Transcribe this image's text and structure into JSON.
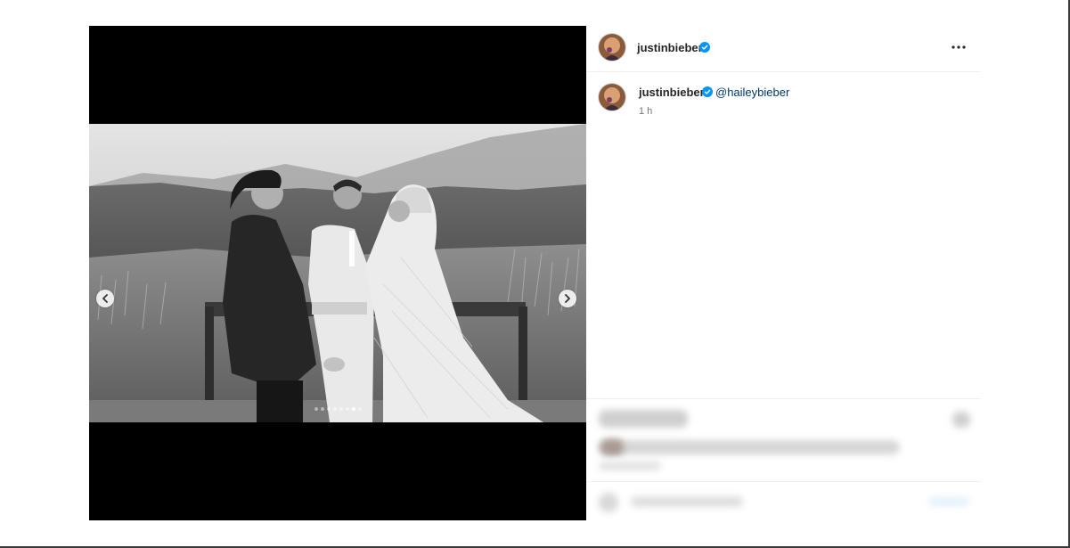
{
  "post": {
    "author": "justinbieber",
    "verified": true,
    "caption_mention": "@haileybieber",
    "time_ago": "1 h"
  },
  "carousel": {
    "slide_count": 8,
    "active_index": 6
  },
  "icons": {
    "verified": "verified-badge-icon",
    "more": "more-options-icon",
    "prev": "chevron-left-icon",
    "next": "chevron-right-icon"
  },
  "colors": {
    "verified_blue": "#0095f6",
    "mention_blue": "#00376b",
    "muted_text": "#737373",
    "media_background": "#000000"
  }
}
